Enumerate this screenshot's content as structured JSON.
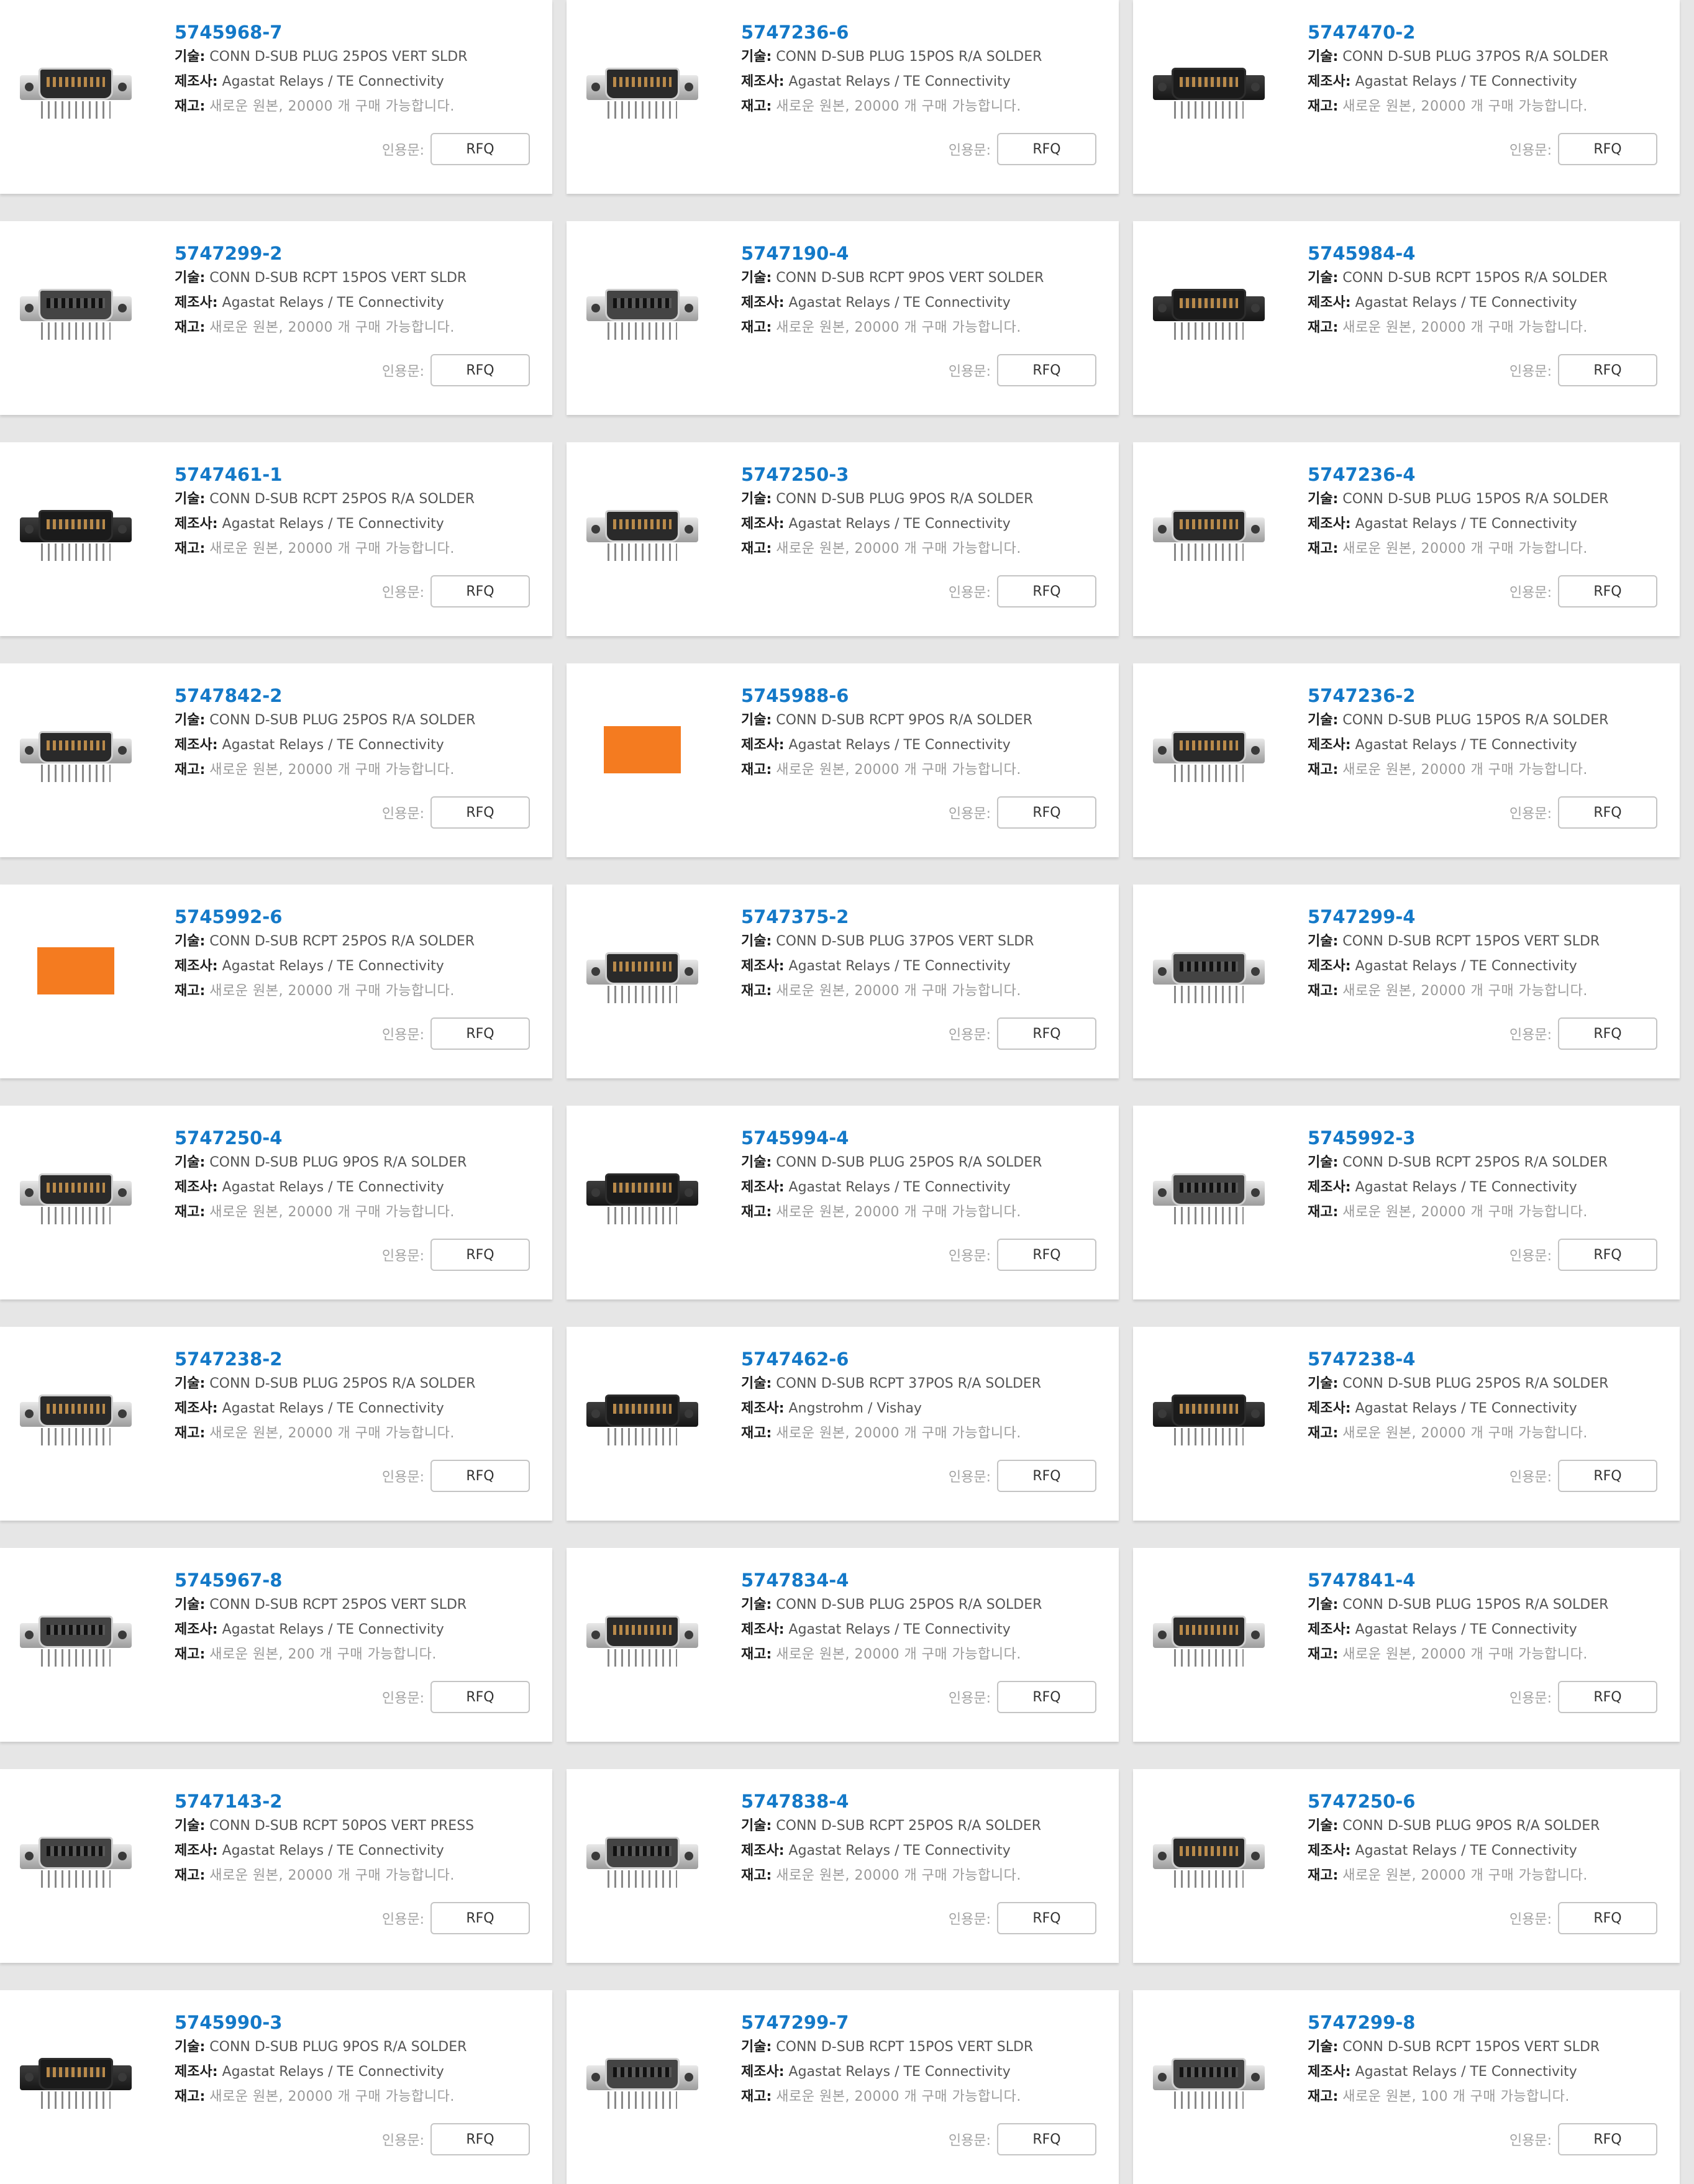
{
  "labels": {
    "desc": "기술:",
    "mfr": "제조사:",
    "stock": "재고:",
    "quote": "인용문:",
    "rfq": "RFQ"
  },
  "brand": {
    "accent": "#1479c8",
    "logo_color": "#f47b20"
  },
  "products": [
    {
      "pn": "5745968-7",
      "desc": "CONN D-SUB PLUG 25POS VERT SLDR",
      "mfr": "Agastat Relays / TE Connectivity",
      "stock": "새로운 원본, 20000 개 구매 가능합니다.",
      "img": "plug"
    },
    {
      "pn": "5747236-6",
      "desc": "CONN D-SUB PLUG 15POS R/A SOLDER",
      "mfr": "Agastat Relays / TE Connectivity",
      "stock": "새로운 원본, 20000 개 구매 가능합니다.",
      "img": "plug"
    },
    {
      "pn": "5747470-2",
      "desc": "CONN D-SUB PLUG 37POS R/A SOLDER",
      "mfr": "Agastat Relays / TE Connectivity",
      "stock": "새로운 원본, 20000 개 구매 가능합니다.",
      "img": "black"
    },
    {
      "pn": "5747299-2",
      "desc": "CONN D-SUB RCPT 15POS VERT SLDR",
      "mfr": "Agastat Relays / TE Connectivity",
      "stock": "새로운 원본, 20000 개 구매 가능합니다.",
      "img": "rcpt"
    },
    {
      "pn": "5747190-4",
      "desc": "CONN D-SUB RCPT 9POS VERT SOLDER",
      "mfr": "Agastat Relays / TE Connectivity",
      "stock": "새로운 원본, 20000 개 구매 가능합니다.",
      "img": "rcpt"
    },
    {
      "pn": "5745984-4",
      "desc": "CONN D-SUB RCPT 15POS R/A SOLDER",
      "mfr": "Agastat Relays / TE Connectivity",
      "stock": "새로운 원본, 20000 개 구매 가능합니다.",
      "img": "black"
    },
    {
      "pn": "5747461-1",
      "desc": "CONN D-SUB RCPT 25POS R/A SOLDER",
      "mfr": "Agastat Relays / TE Connectivity",
      "stock": "새로운 원본, 20000 개 구매 가능합니다.",
      "img": "black"
    },
    {
      "pn": "5747250-3",
      "desc": "CONN D-SUB PLUG 9POS R/A SOLDER",
      "mfr": "Agastat Relays / TE Connectivity",
      "stock": "새로운 원본, 20000 개 구매 가능합니다.",
      "img": "plug"
    },
    {
      "pn": "5747236-4",
      "desc": "CONN D-SUB PLUG 15POS R/A SOLDER",
      "mfr": "Agastat Relays / TE Connectivity",
      "stock": "새로운 원본, 20000 개 구매 가능합니다.",
      "img": "plug"
    },
    {
      "pn": "5747842-2",
      "desc": "CONN D-SUB PLUG 25POS R/A SOLDER",
      "mfr": "Agastat Relays / TE Connectivity",
      "stock": "새로운 원본, 20000 개 구매 가능합니다.",
      "img": "plug"
    },
    {
      "pn": "5745988-6",
      "desc": "CONN D-SUB RCPT 9POS R/A SOLDER",
      "mfr": "Agastat Relays / TE Connectivity",
      "stock": "새로운 원본, 20000 개 구매 가능합니다.",
      "img": "logo"
    },
    {
      "pn": "5747236-2",
      "desc": "CONN D-SUB PLUG 15POS R/A SOLDER",
      "mfr": "Agastat Relays / TE Connectivity",
      "stock": "새로운 원본, 20000 개 구매 가능합니다.",
      "img": "plug"
    },
    {
      "pn": "5745992-6",
      "desc": "CONN D-SUB RCPT 25POS R/A SOLDER",
      "mfr": "Agastat Relays / TE Connectivity",
      "stock": "새로운 원본, 20000 개 구매 가능합니다.",
      "img": "logo"
    },
    {
      "pn": "5747375-2",
      "desc": "CONN D-SUB PLUG 37POS VERT SLDR",
      "mfr": "Agastat Relays / TE Connectivity",
      "stock": "새로운 원본, 20000 개 구매 가능합니다.",
      "img": "plug"
    },
    {
      "pn": "5747299-4",
      "desc": "CONN D-SUB RCPT 15POS VERT SLDR",
      "mfr": "Agastat Relays / TE Connectivity",
      "stock": "새로운 원본, 20000 개 구매 가능합니다.",
      "img": "rcpt"
    },
    {
      "pn": "5747250-4",
      "desc": "CONN D-SUB PLUG 9POS R/A SOLDER",
      "mfr": "Agastat Relays / TE Connectivity",
      "stock": "새로운 원본, 20000 개 구매 가능합니다.",
      "img": "plug"
    },
    {
      "pn": "5745994-4",
      "desc": "CONN D-SUB PLUG 25POS R/A SOLDER",
      "mfr": "Agastat Relays / TE Connectivity",
      "stock": "새로운 원본, 20000 개 구매 가능합니다.",
      "img": "black"
    },
    {
      "pn": "5745992-3",
      "desc": "CONN D-SUB RCPT 25POS R/A SOLDER",
      "mfr": "Agastat Relays / TE Connectivity",
      "stock": "새로운 원본, 20000 개 구매 가능합니다.",
      "img": "rcpt"
    },
    {
      "pn": "5747238-2",
      "desc": "CONN D-SUB PLUG 25POS R/A SOLDER",
      "mfr": "Agastat Relays / TE Connectivity",
      "stock": "새로운 원본, 20000 개 구매 가능합니다.",
      "img": "plug"
    },
    {
      "pn": "5747462-6",
      "desc": "CONN D-SUB RCPT 37POS R/A SOLDER",
      "mfr": "Angstrohm / Vishay",
      "stock": "새로운 원본, 20000 개 구매 가능합니다.",
      "img": "black"
    },
    {
      "pn": "5747238-4",
      "desc": "CONN D-SUB PLUG 25POS R/A SOLDER",
      "mfr": "Agastat Relays / TE Connectivity",
      "stock": "새로운 원본, 20000 개 구매 가능합니다.",
      "img": "black"
    },
    {
      "pn": "5745967-8",
      "desc": "CONN D-SUB RCPT 25POS VERT SLDR",
      "mfr": "Agastat Relays / TE Connectivity",
      "stock": "새로운 원본, 200 개 구매 가능합니다.",
      "img": "rcpt"
    },
    {
      "pn": "5747834-4",
      "desc": "CONN D-SUB PLUG 25POS R/A SOLDER",
      "mfr": "Agastat Relays / TE Connectivity",
      "stock": "새로운 원본, 20000 개 구매 가능합니다.",
      "img": "plug"
    },
    {
      "pn": "5747841-4",
      "desc": "CONN D-SUB PLUG 15POS R/A SOLDER",
      "mfr": "Agastat Relays / TE Connectivity",
      "stock": "새로운 원본, 20000 개 구매 가능합니다.",
      "img": "plug"
    },
    {
      "pn": "5747143-2",
      "desc": "CONN D-SUB RCPT 50POS VERT PRESS",
      "mfr": "Agastat Relays / TE Connectivity",
      "stock": "새로운 원본, 20000 개 구매 가능합니다.",
      "img": "rcpt"
    },
    {
      "pn": "5747838-4",
      "desc": "CONN D-SUB RCPT 25POS R/A SOLDER",
      "mfr": "Agastat Relays / TE Connectivity",
      "stock": "새로운 원본, 20000 개 구매 가능합니다.",
      "img": "rcpt"
    },
    {
      "pn": "5747250-6",
      "desc": "CONN D-SUB PLUG 9POS R/A SOLDER",
      "mfr": "Agastat Relays / TE Connectivity",
      "stock": "새로운 원본, 20000 개 구매 가능합니다.",
      "img": "plug"
    },
    {
      "pn": "5745990-3",
      "desc": "CONN D-SUB PLUG 9POS R/A SOLDER",
      "mfr": "Agastat Relays / TE Connectivity",
      "stock": "새로운 원본, 20000 개 구매 가능합니다.",
      "img": "black"
    },
    {
      "pn": "5747299-7",
      "desc": "CONN D-SUB RCPT 15POS VERT SLDR",
      "mfr": "Agastat Relays / TE Connectivity",
      "stock": "새로운 원본, 20000 개 구매 가능합니다.",
      "img": "rcpt"
    },
    {
      "pn": "5747299-8",
      "desc": "CONN D-SUB RCPT 15POS VERT SLDR",
      "mfr": "Agastat Relays / TE Connectivity",
      "stock": "새로운 원본, 100 개 구매 가능합니다.",
      "img": "rcpt"
    }
  ]
}
